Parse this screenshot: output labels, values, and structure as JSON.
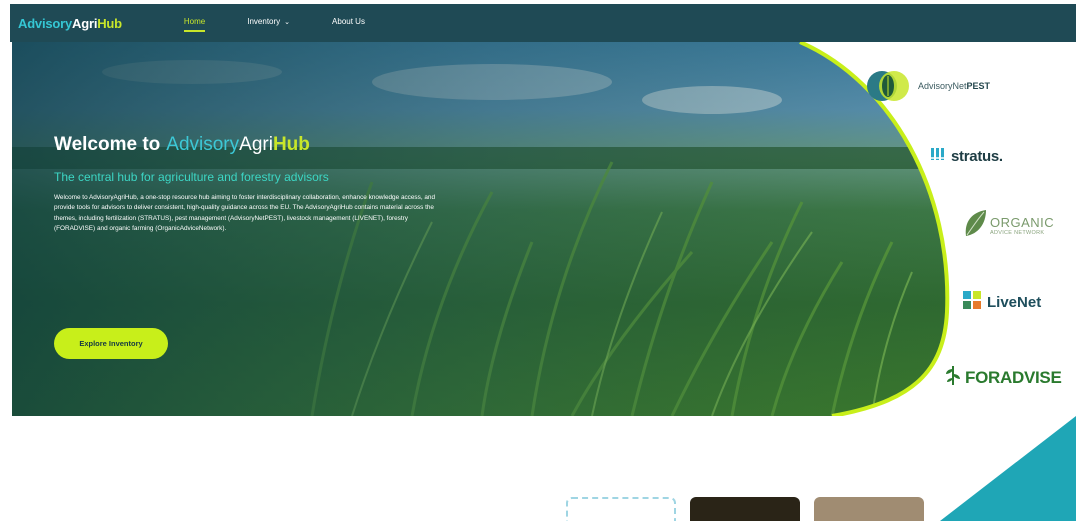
{
  "brand": {
    "part1": "Advisory",
    "part2": "Agri",
    "part3": "Hub"
  },
  "nav": {
    "items": [
      {
        "label": "Home",
        "active": true,
        "has_dropdown": false
      },
      {
        "label": "Inventory",
        "active": false,
        "has_dropdown": true
      },
      {
        "label": "About Us",
        "active": false,
        "has_dropdown": false
      }
    ]
  },
  "hero": {
    "title_prefix": "Welcome to",
    "title_brand_1": "Advisory",
    "title_brand_2": "Agri",
    "title_brand_3": "Hub",
    "subtitle": "The central hub for agriculture and forestry advisors",
    "description": "Welcome to AdvisoryAgriHub, a one-stop resource hub aiming to foster interdisciplinary collaboration, enhance knowledge access, and provide tools for advisors to deliver consistent, high-quality guidance across the EU. The AdvisoryAgriHub contains material across the themes, including fertilization (STRATUS), pest management (AdvisoryNetPEST), livestock management (LIVENET), forestry (FORADVISE) and organic farming (OrganicAdviceNetwork).",
    "cta_label": "Explore Inventory"
  },
  "partners": {
    "pest": {
      "name_regular": "AdvisoryNet",
      "name_bold": "PEST",
      "icon": "leaf-icon"
    },
    "stratus": {
      "name": "stratus.",
      "icon": "stratus-bars-icon"
    },
    "organic": {
      "line1": "ORGANIC",
      "line2": "ADVICE NETWORK",
      "icon": "leaf-icon"
    },
    "livenet": {
      "name": "LiveNet",
      "icon": "livenet-squares-icon"
    },
    "foradvise": {
      "name": "FORADVISE",
      "icon": "fern-icon"
    }
  },
  "colors": {
    "nav_bg": "#1f4a55",
    "accent_lime": "#c8e62a",
    "accent_teal": "#35c6d4",
    "teal_shape": "#1fa6b6"
  }
}
